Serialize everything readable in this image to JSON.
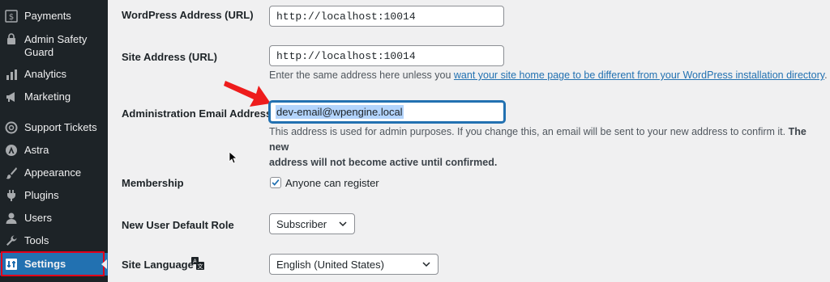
{
  "sidebar": {
    "items": [
      {
        "label": "Payments",
        "icon": "dollar-icon"
      },
      {
        "label": "Admin Safety Guard",
        "icon": "lock-icon"
      },
      {
        "label": "Analytics",
        "icon": "bar-chart-icon"
      },
      {
        "label": "Marketing",
        "icon": "megaphone-icon"
      },
      {
        "label": "Support Tickets",
        "icon": "lifebuoy-icon"
      },
      {
        "label": "Astra",
        "icon": "astra-logo-icon"
      },
      {
        "label": "Appearance",
        "icon": "paintbrush-icon"
      },
      {
        "label": "Plugins",
        "icon": "plug-icon"
      },
      {
        "label": "Users",
        "icon": "user-icon"
      },
      {
        "label": "Tools",
        "icon": "wrench-icon"
      },
      {
        "label": "Settings",
        "icon": "settings-icon",
        "active": true
      }
    ]
  },
  "form": {
    "wordpress_address": {
      "label": "WordPress Address (URL)",
      "value": "http://localhost:10014"
    },
    "site_address": {
      "label": "Site Address (URL)",
      "value": "http://localhost:10014",
      "desc_prefix": "Enter the same address here unless you ",
      "desc_link": "want your site home page to be different from your WordPress installation directory",
      "desc_suffix": "."
    },
    "admin_email": {
      "label": "Administration Email Address",
      "value": "dev-email@wpengine.local",
      "desc_line1": "This address is used for admin purposes. If you change this, an email will be sent to your new address to confirm it.",
      "desc_bold1": " The new",
      "desc_bold2": "address will not become active until confirmed."
    },
    "membership": {
      "label": "Membership",
      "checkbox_label": "Anyone can register",
      "checked": true
    },
    "default_role": {
      "label": "New User Default Role",
      "value": "Subscriber"
    },
    "site_language": {
      "label": "Site Language",
      "value": "English (United States)"
    }
  },
  "colors": {
    "sidebar_bg": "#1d2327",
    "accent": "#2271b1",
    "highlight_red": "#e2001a"
  }
}
